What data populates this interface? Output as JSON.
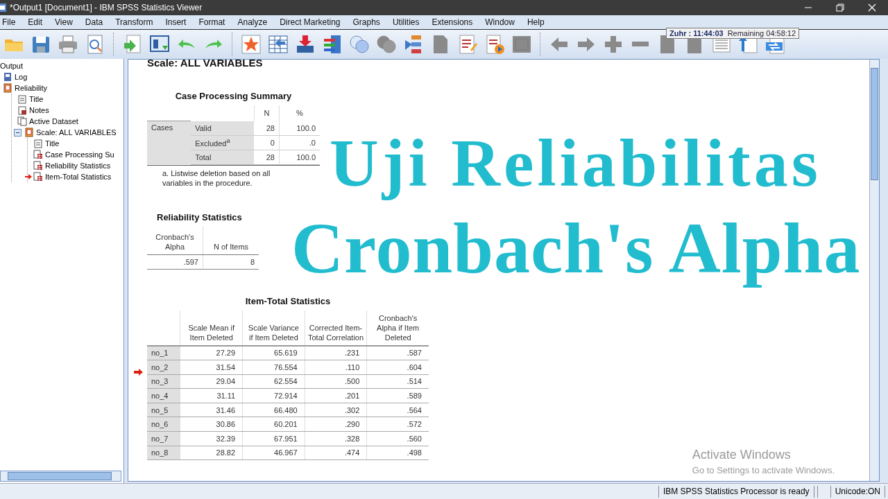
{
  "window": {
    "title": "*Output1 [Document1] - IBM SPSS Statistics Viewer"
  },
  "menu": [
    "File",
    "Edit",
    "View",
    "Data",
    "Transform",
    "Insert",
    "Format",
    "Analyze",
    "Direct Marketing",
    "Graphs",
    "Utilities",
    "Extensions",
    "Window",
    "Help"
  ],
  "toolbar": [
    [
      {
        "kind": "folder",
        "disabled": false
      },
      {
        "kind": "save",
        "disabled": false
      },
      {
        "kind": "print",
        "disabled": false
      },
      {
        "kind": "preview",
        "disabled": false
      }
    ],
    [
      {
        "kind": "export",
        "disabled": false
      },
      {
        "kind": "dialog",
        "disabled": false
      },
      {
        "kind": "undo",
        "disabled": false
      },
      {
        "kind": "redo",
        "disabled": false
      }
    ],
    [
      {
        "kind": "star",
        "disabled": false
      },
      {
        "kind": "grid",
        "disabled": false
      },
      {
        "kind": "insert",
        "disabled": false
      },
      {
        "kind": "variables",
        "disabled": false
      },
      {
        "kind": "circles",
        "disabled": false
      },
      {
        "kind": "circles",
        "disabled": true
      },
      {
        "kind": "tree",
        "disabled": false
      },
      {
        "kind": "doc",
        "disabled": true
      },
      {
        "kind": "edit",
        "disabled": false
      },
      {
        "kind": "script",
        "disabled": false
      },
      {
        "kind": "frame",
        "disabled": true
      }
    ],
    [
      {
        "kind": "left",
        "disabled": true
      },
      {
        "kind": "right",
        "disabled": true
      },
      {
        "kind": "plus",
        "disabled": true
      },
      {
        "kind": "minus",
        "disabled": true
      },
      {
        "kind": "doc",
        "disabled": true
      },
      {
        "kind": "doc",
        "disabled": true
      },
      {
        "kind": "lines",
        "disabled": false
      },
      {
        "kind": "upload",
        "disabled": false
      },
      {
        "kind": "swap",
        "disabled": false
      }
    ]
  ],
  "clock": {
    "prayer": "Zuhr : 11:44:03",
    "remaining": "Remaining 04:58:12"
  },
  "tree": {
    "label": "Output",
    "children": [
      {
        "label": "Log",
        "kind": "log",
        "selected": false
      },
      {
        "label": "Reliability",
        "kind": "section",
        "selected": false,
        "children": [
          {
            "label": "Title",
            "kind": "title",
            "selected": false
          },
          {
            "label": "Notes",
            "kind": "notes",
            "selected": false
          },
          {
            "label": "Active Dataset",
            "kind": "dataset",
            "selected": false
          },
          {
            "label": "Scale: ALL VARIABLES",
            "kind": "section",
            "selected": false,
            "expanded": true,
            "children": [
              {
                "label": "Title",
                "kind": "title",
                "selected": false
              },
              {
                "label": "Case Processing Su",
                "kind": "table",
                "selected": false
              },
              {
                "label": "Reliability Statistics",
                "kind": "table",
                "selected": false
              },
              {
                "label": "Item-Total Statistics",
                "kind": "table",
                "selected": true
              }
            ]
          }
        ]
      }
    ]
  },
  "heading": "Scale: ALL VARIABLES",
  "case_processing": {
    "title": "Case Processing Summary",
    "columns": [
      "N",
      "%"
    ],
    "group": "Cases",
    "rows": [
      {
        "label": "Valid",
        "values": [
          "28",
          "100.0"
        ]
      },
      {
        "label": "Excluded$^{a}$",
        "values": [
          "0",
          ".0"
        ]
      },
      {
        "label": "Total",
        "values": [
          "28",
          "100.0"
        ]
      }
    ],
    "footnote": "a. Listwise deletion based on all variables in the procedure."
  },
  "reliability": {
    "title": "Reliability Statistics",
    "columns": [
      "Cronbach's Alpha",
      "N of Items"
    ],
    "values": [
      ".597",
      "8"
    ]
  },
  "item_total": {
    "title": "Item-Total Statistics",
    "current": true,
    "columns": [
      "Scale Mean if Item Deleted",
      "Scale Variance if Item Deleted",
      "Corrected Item-Total Correlation",
      "Cronbach's Alpha if Item Deleted"
    ],
    "rows": [
      {
        "label": "no_1",
        "values": [
          "27.29",
          "65.619",
          ".231",
          ".587"
        ]
      },
      {
        "label": "no_2",
        "values": [
          "31.54",
          "76.554",
          ".110",
          ".604"
        ]
      },
      {
        "label": "no_3",
        "values": [
          "29.04",
          "62.554",
          ".500",
          ".514"
        ]
      },
      {
        "label": "no_4",
        "values": [
          "31.11",
          "72.914",
          ".201",
          ".589"
        ]
      },
      {
        "label": "no_5",
        "values": [
          "31.46",
          "66.480",
          ".302",
          ".564"
        ]
      },
      {
        "label": "no_6",
        "values": [
          "30.86",
          "60.201",
          ".290",
          ".572"
        ]
      },
      {
        "label": "no_7",
        "values": [
          "32.39",
          "67.951",
          ".328",
          ".560"
        ]
      },
      {
        "label": "no_8",
        "values": [
          "28.82",
          "46.967",
          ".474",
          ".498"
        ]
      }
    ]
  },
  "overlay": [
    "Uji Reliabilitas",
    "Cronbach's Alpha"
  ],
  "activation": {
    "title": "Activate Windows",
    "text": "Go to Settings to activate Windows."
  },
  "status_bar": [
    "IBM SPSS Statistics Processor is ready",
    "Unicode:ON"
  ]
}
